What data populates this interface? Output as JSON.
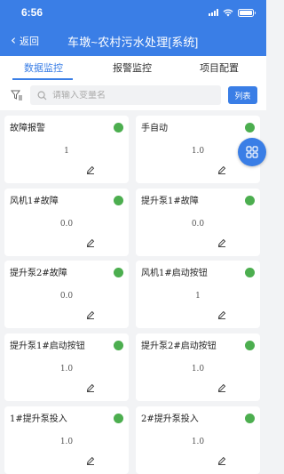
{
  "status_bar": {
    "time": "6:56"
  },
  "nav": {
    "back_label": "返回",
    "title": "车墩~农村污水处理[系统]"
  },
  "tabs": [
    {
      "label": "数据监控",
      "active": true
    },
    {
      "label": "报警监控",
      "active": false
    },
    {
      "label": "项目配置",
      "active": false
    }
  ],
  "search": {
    "placeholder": "请输入变量名",
    "list_button": "列表"
  },
  "cards": [
    {
      "title": "故障报警",
      "value": "1",
      "status": "green"
    },
    {
      "title": "手自动",
      "value": "1.0",
      "status": "green"
    },
    {
      "title": "风机1#故障",
      "value": "0.0",
      "status": "green"
    },
    {
      "title": "提升泵1#故障",
      "value": "0.0",
      "status": "green"
    },
    {
      "title": "提升泵2#故障",
      "value": "0.0",
      "status": "green"
    },
    {
      "title": "风机1#启动按钮",
      "value": "1",
      "status": "green"
    },
    {
      "title": "提升泵1#启动按钮",
      "value": "1.0",
      "status": "green"
    },
    {
      "title": "提升泵2#启动按钮",
      "value": "1.0",
      "status": "green"
    },
    {
      "title": "1#提升泵投入",
      "value": "1.0",
      "status": "green"
    },
    {
      "title": "2#提升泵投入",
      "value": "1.0",
      "status": "green"
    }
  ],
  "colors": {
    "primary": "#3a7ee6",
    "status_green": "#4cae4f",
    "background": "#f2f3f5"
  },
  "icons": {
    "filter": "filter-icon",
    "search": "search-icon",
    "edit": "pencil-icon",
    "fab": "grid-icon"
  }
}
